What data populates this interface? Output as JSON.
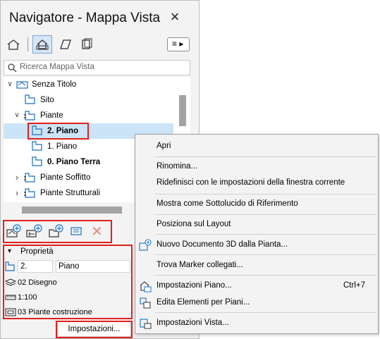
{
  "window": {
    "title": "Navigatore - Mappa Vista",
    "close_icon": "×"
  },
  "toolbar": {
    "icons": [
      "project-map-icon",
      "view-map-icon",
      "layout-book-icon",
      "publisher-icon"
    ],
    "menu_icon": "≡ ▸"
  },
  "search": {
    "placeholder": "Ricerca Mappa Vista"
  },
  "tree": {
    "items": [
      {
        "label": "Senza Titolo",
        "toggle": "∨",
        "bold": false
      },
      {
        "label": "Sito",
        "toggle": "",
        "bold": false
      },
      {
        "label": "Piante",
        "toggle": "∨",
        "bold": false
      },
      {
        "label": "2. Piano",
        "toggle": "",
        "bold": true,
        "selected": true
      },
      {
        "label": "1. Piano",
        "toggle": "",
        "bold": false
      },
      {
        "label": "0. Piano Terra",
        "toggle": "",
        "bold": true
      },
      {
        "label": "Piante Soffitto",
        "toggle": "›",
        "bold": false
      },
      {
        "label": "Piante Strutturali",
        "toggle": "›",
        "bold": false
      }
    ]
  },
  "bottom_toolbar": {
    "delete_icon": "✕"
  },
  "properties": {
    "header": "Proprietà",
    "toggle": "▾",
    "id_value": "2.",
    "name_value": "Piano",
    "layer_combo": "02 Disegno",
    "scale": "1:100",
    "model_view": "03 Piante costruzione",
    "settings_button": "Impostazioni..."
  },
  "context_menu": {
    "items": [
      {
        "label": "Apri",
        "shortcut": ""
      },
      {
        "label": "Rinomina...",
        "shortcut": ""
      },
      {
        "label": "Ridefinisci con le impostazioni della finestra corrente",
        "shortcut": ""
      },
      {
        "label": "Mostra come Sottolucido di Riferimento",
        "shortcut": ""
      },
      {
        "label": "Posiziona sul Layout",
        "shortcut": ""
      },
      {
        "label": "Nuovo Documento 3D dalla Pianta...",
        "shortcut": ""
      },
      {
        "label": "Trova Marker collegati...",
        "shortcut": ""
      },
      {
        "label": "Impostazioni Piano...",
        "shortcut": "Ctrl+7"
      },
      {
        "label": "Edita Elementi per Piani...",
        "shortcut": ""
      },
      {
        "label": "Impostazioni Vista...",
        "shortcut": ""
      }
    ]
  },
  "colors": {
    "highlight": "#e0201c",
    "selection": "#cce4f7",
    "icon_blue": "#1a6fc4"
  }
}
